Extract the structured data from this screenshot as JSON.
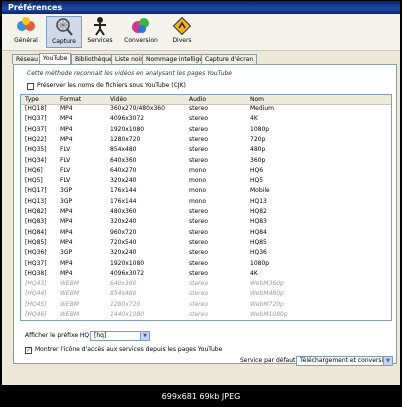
{
  "window": {
    "title": "Préférences"
  },
  "toolbar": {
    "items": [
      {
        "label": "Général",
        "icon": "general-icon"
      },
      {
        "label": "Capture",
        "icon": "capture-icon",
        "selected": true
      },
      {
        "label": "Services",
        "icon": "services-icon"
      },
      {
        "label": "Conversion",
        "icon": "conversion-icon"
      },
      {
        "label": "Divers",
        "icon": "divers-icon"
      }
    ]
  },
  "tabs": [
    {
      "label": "Réseau"
    },
    {
      "label": "YouTube",
      "active": true
    },
    {
      "label": "Bibliothèques"
    },
    {
      "label": "Liste noire"
    },
    {
      "label": "Nommage intelligent"
    },
    {
      "label": "Capture d'écran"
    }
  ],
  "panel": {
    "description": "Cette méthode reconnait les vidéos en analysant les pages YouTube",
    "preserve_label": "Préserver les noms de fichiers sous YouTube (CJK)",
    "preserve_checked": false
  },
  "table": {
    "columns": [
      "Type",
      "Format",
      "Vidéo",
      "Audio",
      "Nom"
    ],
    "rows": [
      [
        "[HQ18]",
        "MP4",
        "360x270/480x360",
        "stereo",
        "Medium"
      ],
      [
        "[HQ37]",
        "MP4",
        "4096x3072",
        "stereo",
        "4K"
      ],
      [
        "[HQ37]",
        "MP4",
        "1920x1080",
        "stereo",
        "1080p"
      ],
      [
        "[HQ22]",
        "MP4",
        "1280x720",
        "stereo",
        "720p"
      ],
      [
        "[HQ35]",
        "FLV",
        "854x480",
        "stereo",
        "480p"
      ],
      [
        "[HQ34]",
        "FLV",
        "640x360",
        "stereo",
        "360p"
      ],
      [
        "[HQ6]",
        "FLV",
        "640x270",
        "mono",
        "HQ6"
      ],
      [
        "[HQ5]",
        "FLV",
        "320x240",
        "mono",
        "HQ5"
      ],
      [
        "[HQ17]",
        "3GP",
        "176x144",
        "mono",
        "Mobile"
      ],
      [
        "[HQ13]",
        "3GP",
        "176x144",
        "mono",
        "HQ13"
      ],
      [
        "[HQ82]",
        "MP4",
        "480x360",
        "stereo",
        "HQ82"
      ],
      [
        "[HQ83]",
        "MP4",
        "320x240",
        "stereo",
        "HQ83"
      ],
      [
        "[HQ84]",
        "MP4",
        "960x720",
        "stereo",
        "HQ84"
      ],
      [
        "[HQ85]",
        "MP4",
        "720x540",
        "stereo",
        "HQ85"
      ],
      [
        "[HQ36]",
        "3GP",
        "320x240",
        "stereo",
        "HQ36"
      ],
      [
        "[HQ37]",
        "MP4",
        "1920x1080",
        "stereo",
        "1080p"
      ],
      [
        "[HQ38]",
        "MP4",
        "4096x3072",
        "stereo",
        "4K"
      ],
      [
        "[HQ43]",
        "WEBM",
        "640x360",
        "stereo",
        "WebM360p"
      ],
      [
        "[HQ44]",
        "WEBM",
        "854x480",
        "stereo",
        "WebM480p"
      ],
      [
        "[HQ45]",
        "WEBM",
        "1280x720",
        "stereo",
        "WebM720p"
      ],
      [
        "[HQ46]",
        "WEBM",
        "1440x1080",
        "stereo",
        "WebM1080p"
      ]
    ],
    "dimmed_from": 17
  },
  "prefix": {
    "label": "Afficher le préfixe HQ",
    "value": "[hq]"
  },
  "show_icon": {
    "label": "Montrer l'icône d'accès aux services depuis les pages YouTube",
    "checked": true
  },
  "default_service": {
    "label": "Service par défaut",
    "value": "Téléchargement et conversion"
  },
  "footer": {
    "text": "699x681 69kb JPEG"
  },
  "colors": {
    "titlebar": "#0a246a",
    "window": "#ece9d8",
    "selected_tool": "#cfd9ec"
  }
}
